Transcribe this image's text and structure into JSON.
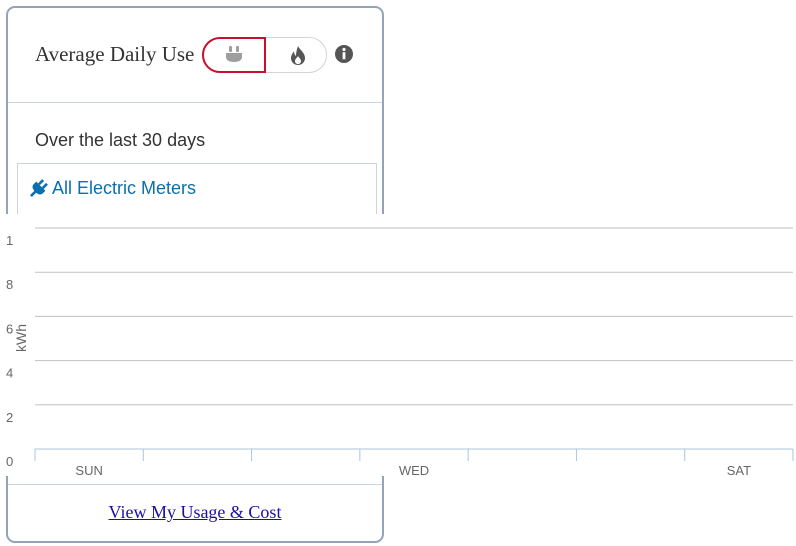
{
  "card": {
    "title": "Average Daily Use",
    "toggle": {
      "selected": "electric",
      "options": [
        "electric",
        "gas"
      ]
    },
    "subtitle": "Over the last 30 days",
    "meter_select": {
      "label": "All Electric Meters"
    },
    "footer_link": "View My Usage & Cost"
  },
  "icons": {
    "toggle_electric": "plug-icon",
    "toggle_gas": "flame-icon",
    "info": "info-icon",
    "meter": "plug-icon"
  },
  "colors": {
    "accent_red": "#c8102e",
    "link_blue": "#0b6fae",
    "footer_link": "#1a0dab",
    "card_border": "#94a3b8",
    "gridline": "#c0c0c0"
  },
  "chart_data": {
    "type": "bar",
    "ylabel": "kWh",
    "ylim": [
      0,
      1
    ],
    "y_ticks": [
      "1",
      "8",
      "6",
      "4",
      "2",
      "0"
    ],
    "categories": [
      "SUN",
      "",
      "",
      "WED",
      "",
      "",
      "SAT"
    ],
    "values": [],
    "grid": true
  }
}
